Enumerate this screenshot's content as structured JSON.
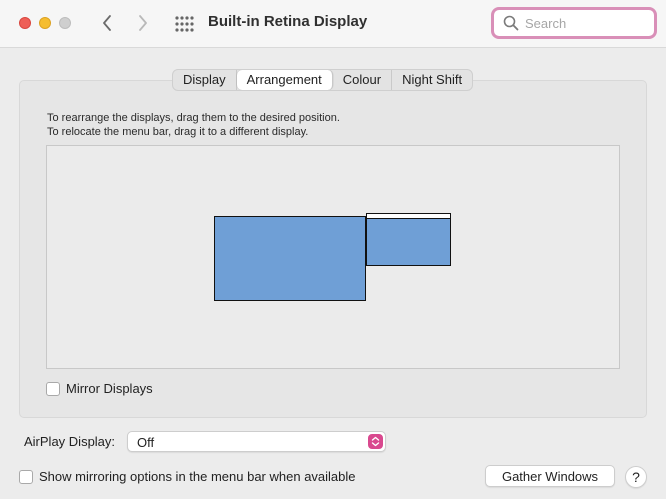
{
  "window": {
    "title": "Built-in Retina Display"
  },
  "titlebar": {
    "controls": [
      "close-button",
      "minimize-button",
      "zoom-button"
    ],
    "nav_icons": [
      "chevron-left-icon",
      "chevron-right-icon",
      "grid-icon"
    ]
  },
  "search": {
    "placeholder": "Search",
    "value": "",
    "icon": "search-icon",
    "focus_color": "#d98fb8"
  },
  "tabs": [
    {
      "label": "Display",
      "active": false
    },
    {
      "label": "Arrangement",
      "active": true
    },
    {
      "label": "Colour",
      "active": false
    },
    {
      "label": "Night Shift",
      "active": false
    }
  ],
  "arrangement": {
    "instruction_line1": "To rearrange the displays, drag them to the desired position.",
    "instruction_line2": "To relocate the menu bar, drag it to a different display.",
    "display_color": "#6f9fd6"
  },
  "mirror": {
    "label": "Mirror Displays",
    "checked": false
  },
  "airplay": {
    "label": "AirPlay Display:",
    "value": "Off",
    "accent": "#d9498f"
  },
  "show_mirroring": {
    "label": "Show mirroring options in the menu bar when available",
    "checked": false
  },
  "buttons": {
    "gather": "Gather Windows",
    "help": "?"
  }
}
